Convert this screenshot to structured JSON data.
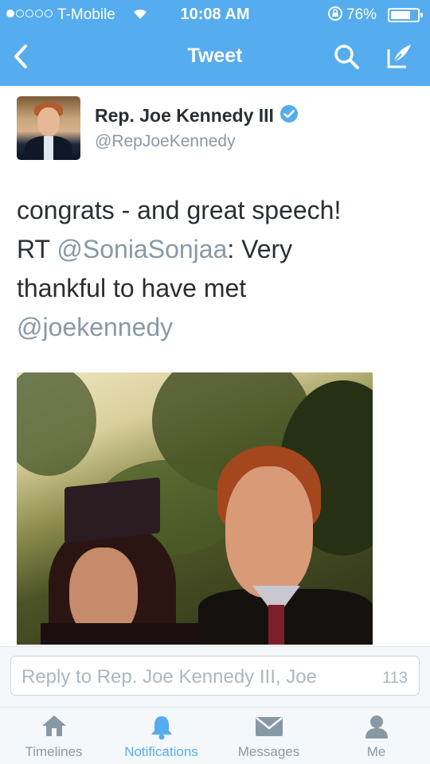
{
  "status_bar": {
    "carrier": "T-Mobile",
    "time": "10:08 AM",
    "battery": "76%",
    "battery_level": 0.76
  },
  "nav": {
    "title": "Tweet",
    "back_icon": "chevron-left-icon",
    "search_icon": "search-icon",
    "compose_icon": "compose-icon"
  },
  "tweet": {
    "author_name": "Rep. Joe Kennedy III",
    "author_handle": "@RepJoeKennedy",
    "verified": true,
    "text_1": "congrats - and great speech!",
    "text_rt": "RT ",
    "mention_1": "@SoniaSonjaa",
    "text_2": ": Very",
    "text_3": "thankful to have met",
    "mention_2": "@joekennedy"
  },
  "reply": {
    "placeholder": "Reply to Rep. Joe Kennedy III, Joe",
    "char_count": "113"
  },
  "tabs": [
    {
      "label": "Timelines",
      "icon": "home-icon",
      "active": false
    },
    {
      "label": "Notifications",
      "icon": "bell-icon",
      "active": true
    },
    {
      "label": "Messages",
      "icon": "envelope-icon",
      "active": false
    },
    {
      "label": "Me",
      "icon": "person-icon",
      "active": false
    }
  ],
  "colors": {
    "brand_blue": "#55acee",
    "text": "#292f33",
    "muted": "#8899a6"
  }
}
